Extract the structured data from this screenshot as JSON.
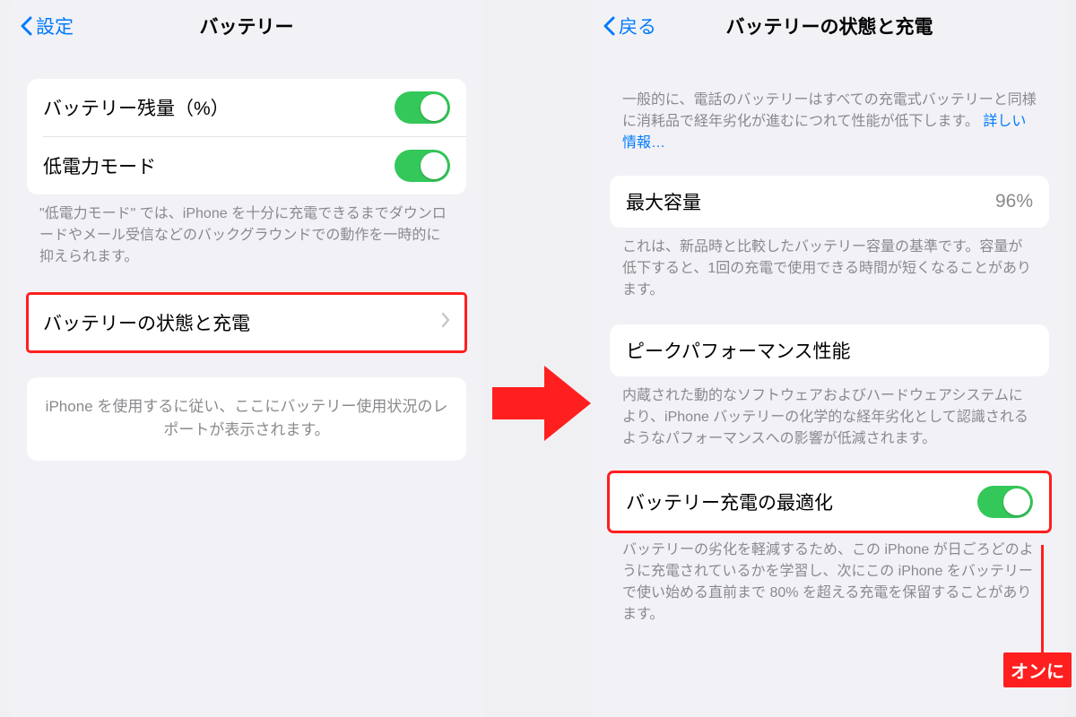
{
  "left": {
    "nav": {
      "back": "設定",
      "title": "バッテリー"
    },
    "rows": {
      "battery_percent": "バッテリー残量（%）",
      "low_power": "低電力モード"
    },
    "lowpower_desc": "\"低電力モード\" では、iPhone を十分に充電できるまでダウンロードやメール受信などのバックグラウンドでの動作を一時的に抑えられます。",
    "health_link": "バッテリーの状態と充電",
    "usage_info": "iPhone を使用するに従い、ここにバッテリー使用状況のレポートが表示されます。"
  },
  "right": {
    "nav": {
      "back": "戻る",
      "title": "バッテリーの状態と充電"
    },
    "intro_part1": "一般的に、電話のバッテリーはすべての充電式バッテリーと同様に消耗品で経年劣化が進むにつれて性能が低下します。",
    "intro_link": "詳しい情報…",
    "max_cap": {
      "label": "最大容量",
      "value": "96%"
    },
    "max_cap_desc": "これは、新品時と比較したバッテリー容量の基準です。容量が低下すると、1回の充電で使用できる時間が短くなることがあります。",
    "peak": {
      "label": "ピークパフォーマンス性能"
    },
    "peak_desc": "内蔵された動的なソフトウェアおよびハードウェアシステムにより、iPhone バッテリーの化学的な経年劣化として認識されるようなパフォーマンスへの影響が低減されます。",
    "opt": {
      "label": "バッテリー充電の最適化"
    },
    "opt_desc": "バッテリーの劣化を軽減するため、この iPhone が日ごろどのように充電されているかを学習し、次にこの iPhone をバッテリーで使い始める直前まで 80% を超える充電を保留することがあります。",
    "on_badge": "オンに"
  }
}
